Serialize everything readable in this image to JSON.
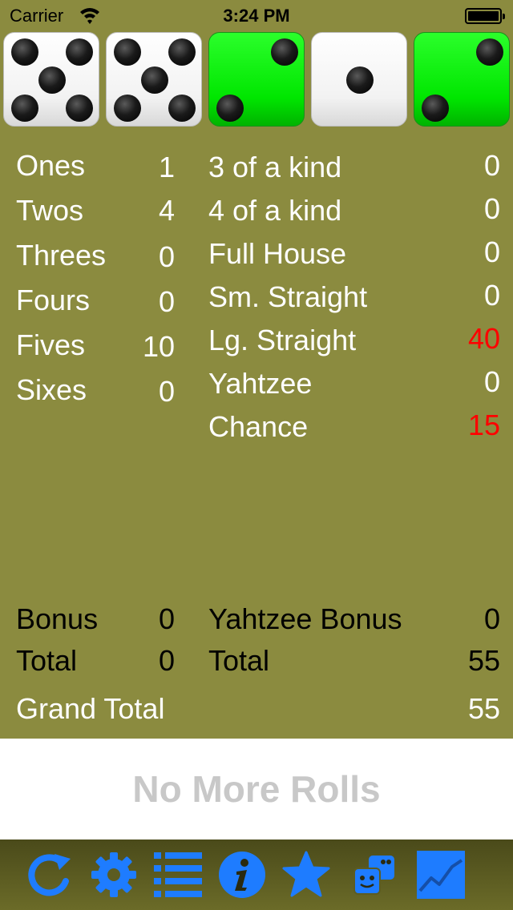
{
  "status_bar": {
    "carrier": "Carrier",
    "time": "3:24 PM",
    "icons": [
      "wifi-icon",
      "battery-icon"
    ]
  },
  "dice": [
    {
      "value": 5,
      "held": false
    },
    {
      "value": 5,
      "held": false
    },
    {
      "value": 2,
      "held": true
    },
    {
      "value": 1,
      "held": false
    },
    {
      "value": 2,
      "held": true
    }
  ],
  "colors": {
    "background": "#8b8b3f",
    "held_die": "#00e600",
    "highlight_score": "#ff0000",
    "toolbar_icon": "#1e7cff",
    "roll_disabled_text": "#c8c8c8"
  },
  "upper": [
    {
      "label": "Ones",
      "score": "1"
    },
    {
      "label": "Twos",
      "score": "4"
    },
    {
      "label": "Threes",
      "score": "0"
    },
    {
      "label": "Fours",
      "score": "0"
    },
    {
      "label": "Fives",
      "score": "10"
    },
    {
      "label": "Sixes",
      "score": "0"
    }
  ],
  "lower": [
    {
      "label": "3 of a kind",
      "score": "0",
      "highlight": false
    },
    {
      "label": "4 of a kind",
      "score": "0",
      "highlight": false
    },
    {
      "label": "Full House",
      "score": "0",
      "highlight": false
    },
    {
      "label": "Sm. Straight",
      "score": "0",
      "highlight": false
    },
    {
      "label": "Lg. Straight",
      "score": "40",
      "highlight": true
    },
    {
      "label": "Yahtzee",
      "score": "0",
      "highlight": false
    },
    {
      "label": "Chance",
      "score": "15",
      "highlight": true
    }
  ],
  "totals": {
    "bonus_label": "Bonus",
    "bonus": "0",
    "upper_total_label": "Total",
    "upper_total": "0",
    "yahtzee_bonus_label": "Yahtzee Bonus",
    "yahtzee_bonus": "0",
    "lower_total_label": "Total",
    "lower_total": "55",
    "grand_total_label": "Grand Total",
    "grand_total": "55"
  },
  "roll_button": {
    "label": "No More Rolls",
    "enabled": false
  },
  "toolbar": {
    "items": [
      "new-game-icon",
      "settings-icon",
      "scores-list-icon",
      "info-icon",
      "favorite-icon",
      "game-center-icon",
      "stats-icon"
    ]
  }
}
